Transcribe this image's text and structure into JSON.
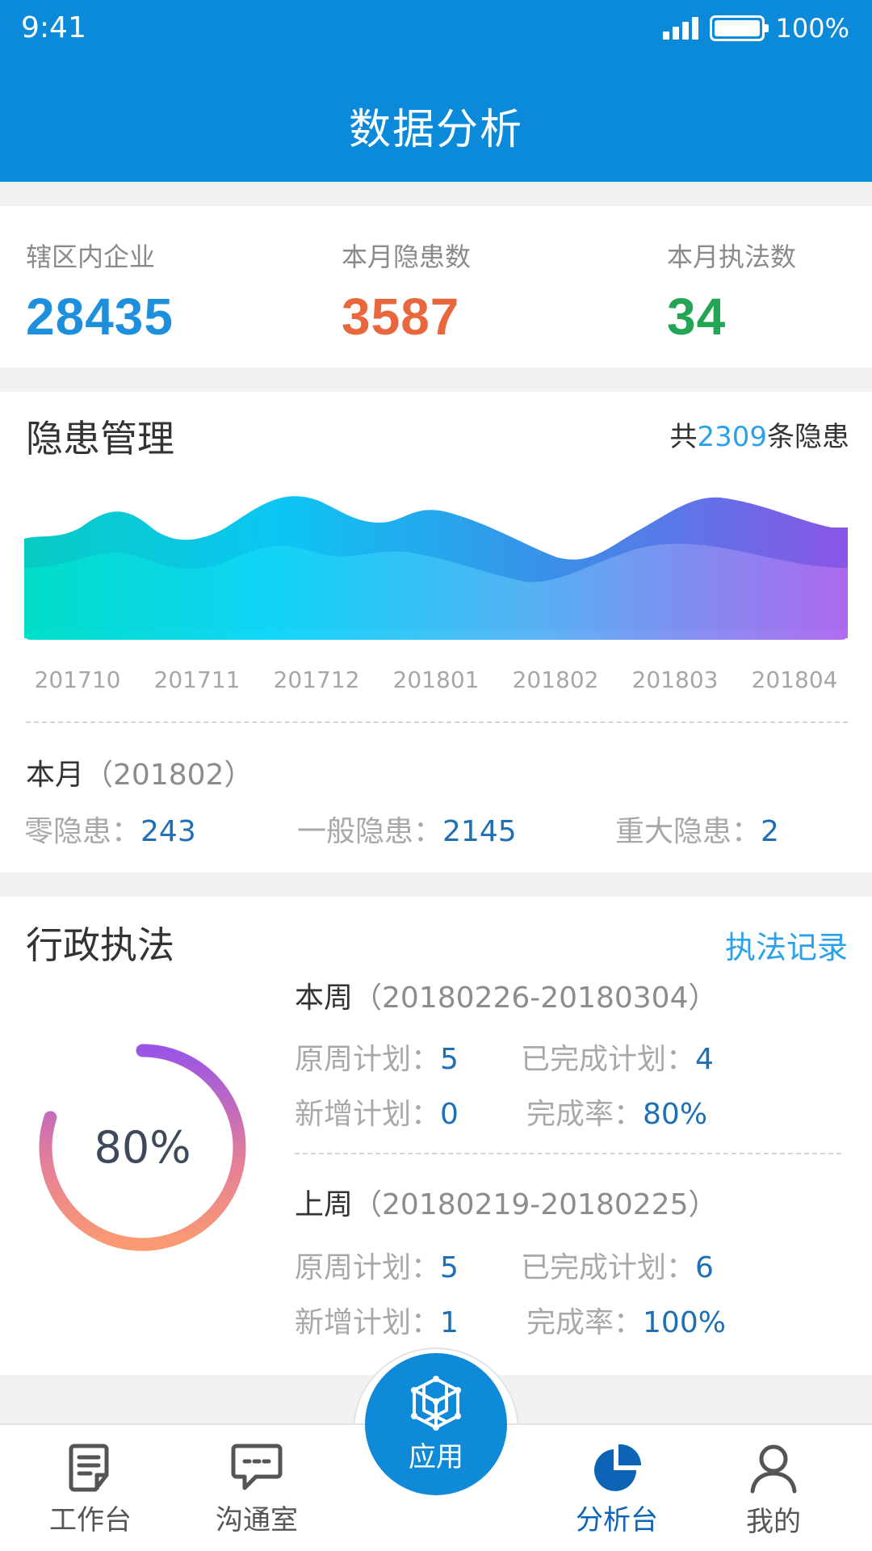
{
  "status_bar": {
    "time": "9:41",
    "battery": "100%"
  },
  "header": {
    "title": "数据分析"
  },
  "stats": [
    {
      "label": "辖区内企业",
      "value": "28435",
      "color": "#1e8fdc"
    },
    {
      "label": "本月隐患数",
      "value": "3587",
      "color": "#e8673d"
    },
    {
      "label": "本月执法数",
      "value": "34",
      "color": "#23a555"
    }
  ],
  "hazard": {
    "title": "隐患管理",
    "total_prefix": "共",
    "total_count": "2309",
    "total_suffix": "条隐患",
    "month_label": "本月",
    "month_value": "（201802）",
    "items": [
      {
        "label": "零隐患：",
        "value": "243"
      },
      {
        "label": "一般隐患：",
        "value": "2145"
      },
      {
        "label": "重大隐患：",
        "value": "2"
      }
    ]
  },
  "chart_data": {
    "type": "area",
    "categories": [
      "201710",
      "201711",
      "201712",
      "201801",
      "201802",
      "201803",
      "201804"
    ],
    "title": "",
    "xlabel": "",
    "ylabel": ""
  },
  "enforcement": {
    "title": "行政执法",
    "link": "执法记录",
    "progress_label": "80%",
    "progress_value": 0.8,
    "this_week": {
      "label": "本周",
      "range": "（20180226-20180304）",
      "planned_label": "原周计划：",
      "planned": "5",
      "done_label": "已完成计划：",
      "done": "4",
      "added_label": "新增计划：",
      "added": "0",
      "rate_label": "完成率：",
      "rate": "80%"
    },
    "last_week": {
      "label": "上周",
      "range": "（20180219-20180225）",
      "planned_label": "原周计划：",
      "planned": "5",
      "done_label": "已完成计划：",
      "done": "6",
      "added_label": "新增计划：",
      "added": "1",
      "rate_label": "完成率：",
      "rate": "100%"
    }
  },
  "tabbar": {
    "workbench": "工作台",
    "chat": "沟通室",
    "apps": "应用",
    "analysis": "分析台",
    "mine": "我的"
  }
}
